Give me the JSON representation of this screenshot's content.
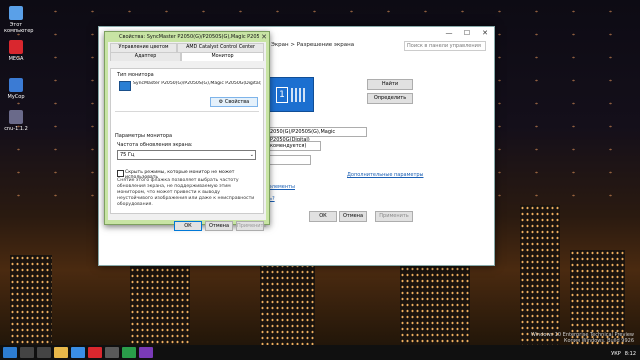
{
  "desktop_icons": [
    {
      "label": "Этот компьютер",
      "icon": "computer-icon",
      "color": "#5aa0e8"
    },
    {
      "label": "MEGA",
      "icon": "mega-icon",
      "color": "#d9272e"
    },
    {
      "label": "MyCop",
      "icon": "app-icon",
      "color": "#3b7bd4"
    },
    {
      "label": "cnu-1.1.2",
      "icon": "app-icon",
      "color": "#6a6a8a"
    }
  ],
  "display_window": {
    "breadcrumb": "Экран  >  Разрешение экрана",
    "search_placeholder": "Поиск в панели управления",
    "buttons": {
      "find": "Найти",
      "identify": "Определить",
      "ok": "ОК",
      "cancel": "Отмена",
      "apply": "Применить"
    },
    "monitor_number": "1",
    "display_dropdown": "2050(G)/P2050S(G),Magic P2050G(Digital)",
    "resolution_dropdown": "комендуется)",
    "advanced_link": "Дополнительные параметры",
    "link1": "элементы",
    "link2": "ь?"
  },
  "dialog": {
    "title": "Свойства: SyncMaster P2050(G)/P2050S(G),Magic P2050G(Digital)",
    "tabs_row1": [
      "Управление цветом",
      "AMD Catalyst Control Center"
    ],
    "tabs_row2": [
      "Адаптер",
      "Монитор"
    ],
    "monitor_type_label": "Тип монитора",
    "monitor_name": "SyncMaster P2050(G)/P2050S(G),Magic P2050G(Digital)",
    "properties_button": "Свойства",
    "params_label": "Параметры монитора",
    "refresh_label": "Частота обновления экрана:",
    "refresh_value": "75 Гц",
    "hide_modes_label": "Скрыть режимы, которые монитор не может использовать",
    "note": "Снятие этого флажка позволяет выбрать частоту обновления экрана, не поддерживаемую этим монитором, что может привести к выводу неустойчивого изображения или даже к неисправности оборудования.",
    "buttons": {
      "ok": "ОК",
      "cancel": "Отмена",
      "apply": "Применить"
    }
  },
  "watermark": {
    "line1": "Windows 10 Enterprise Technical Preview",
    "line2": "Копия Windows. Build 9926"
  },
  "tray": {
    "lang": "УКР",
    "time": "8:12"
  },
  "colors": {
    "dialog_frame": "#c8e4a4",
    "monitor_preview": "#1c6fd0",
    "link": "#1a5fb4"
  }
}
